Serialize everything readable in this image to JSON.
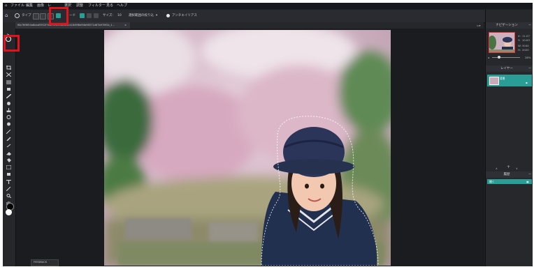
{
  "menu": {
    "items": [
      "ファイル",
      "編集",
      "画像",
      "レ",
      "",
      "選択",
      "調整",
      "フィルター",
      "見る",
      "ヘルプ"
    ]
  },
  "options": {
    "type_label": "タイプ",
    "mode_label": "ード",
    "size_label": "サイズ:",
    "size_value": "10",
    "edge_label": "選択範囲の絞り込",
    "antialias_label": "アンチエイリアス"
  },
  "document": {
    "tab_title": "f6e76f6f54a6bad5952f7baf9e3e05b5b3c41849f8d94b98571d67b978f1b_1...",
    "tab_close": "×"
  },
  "navigation": {
    "title": "ナビゲーション",
    "x_label": "X:",
    "x_value": "11.07",
    "y_label": "Y:",
    "y_value": "10.63",
    "w_label": "W:",
    "w_value": "3040",
    "h_label": "H:",
    "h_value": "2020",
    "zoom_value": "28%"
  },
  "layers": {
    "title": "レイヤー",
    "items": [
      {
        "name": "背景"
      }
    ]
  },
  "history": {
    "title": "履歴",
    "items": [
      {
        "name": "開く"
      }
    ]
  },
  "footer": {
    "feedback_label": "FEEDBACK"
  },
  "colors": {
    "accent": "#2a9d96",
    "highlight": "#e0141c",
    "panel_bg": "#27282c",
    "app_bg": "#1f2024"
  },
  "icons": [
    "home-icon",
    "lasso-icon",
    "magic-wand-icon",
    "quick-select-icon",
    "move-icon",
    "crop-icon",
    "brush-icon",
    "eraser-icon",
    "text-icon",
    "zoom-icon",
    "hand-icon",
    "gear-icon"
  ]
}
